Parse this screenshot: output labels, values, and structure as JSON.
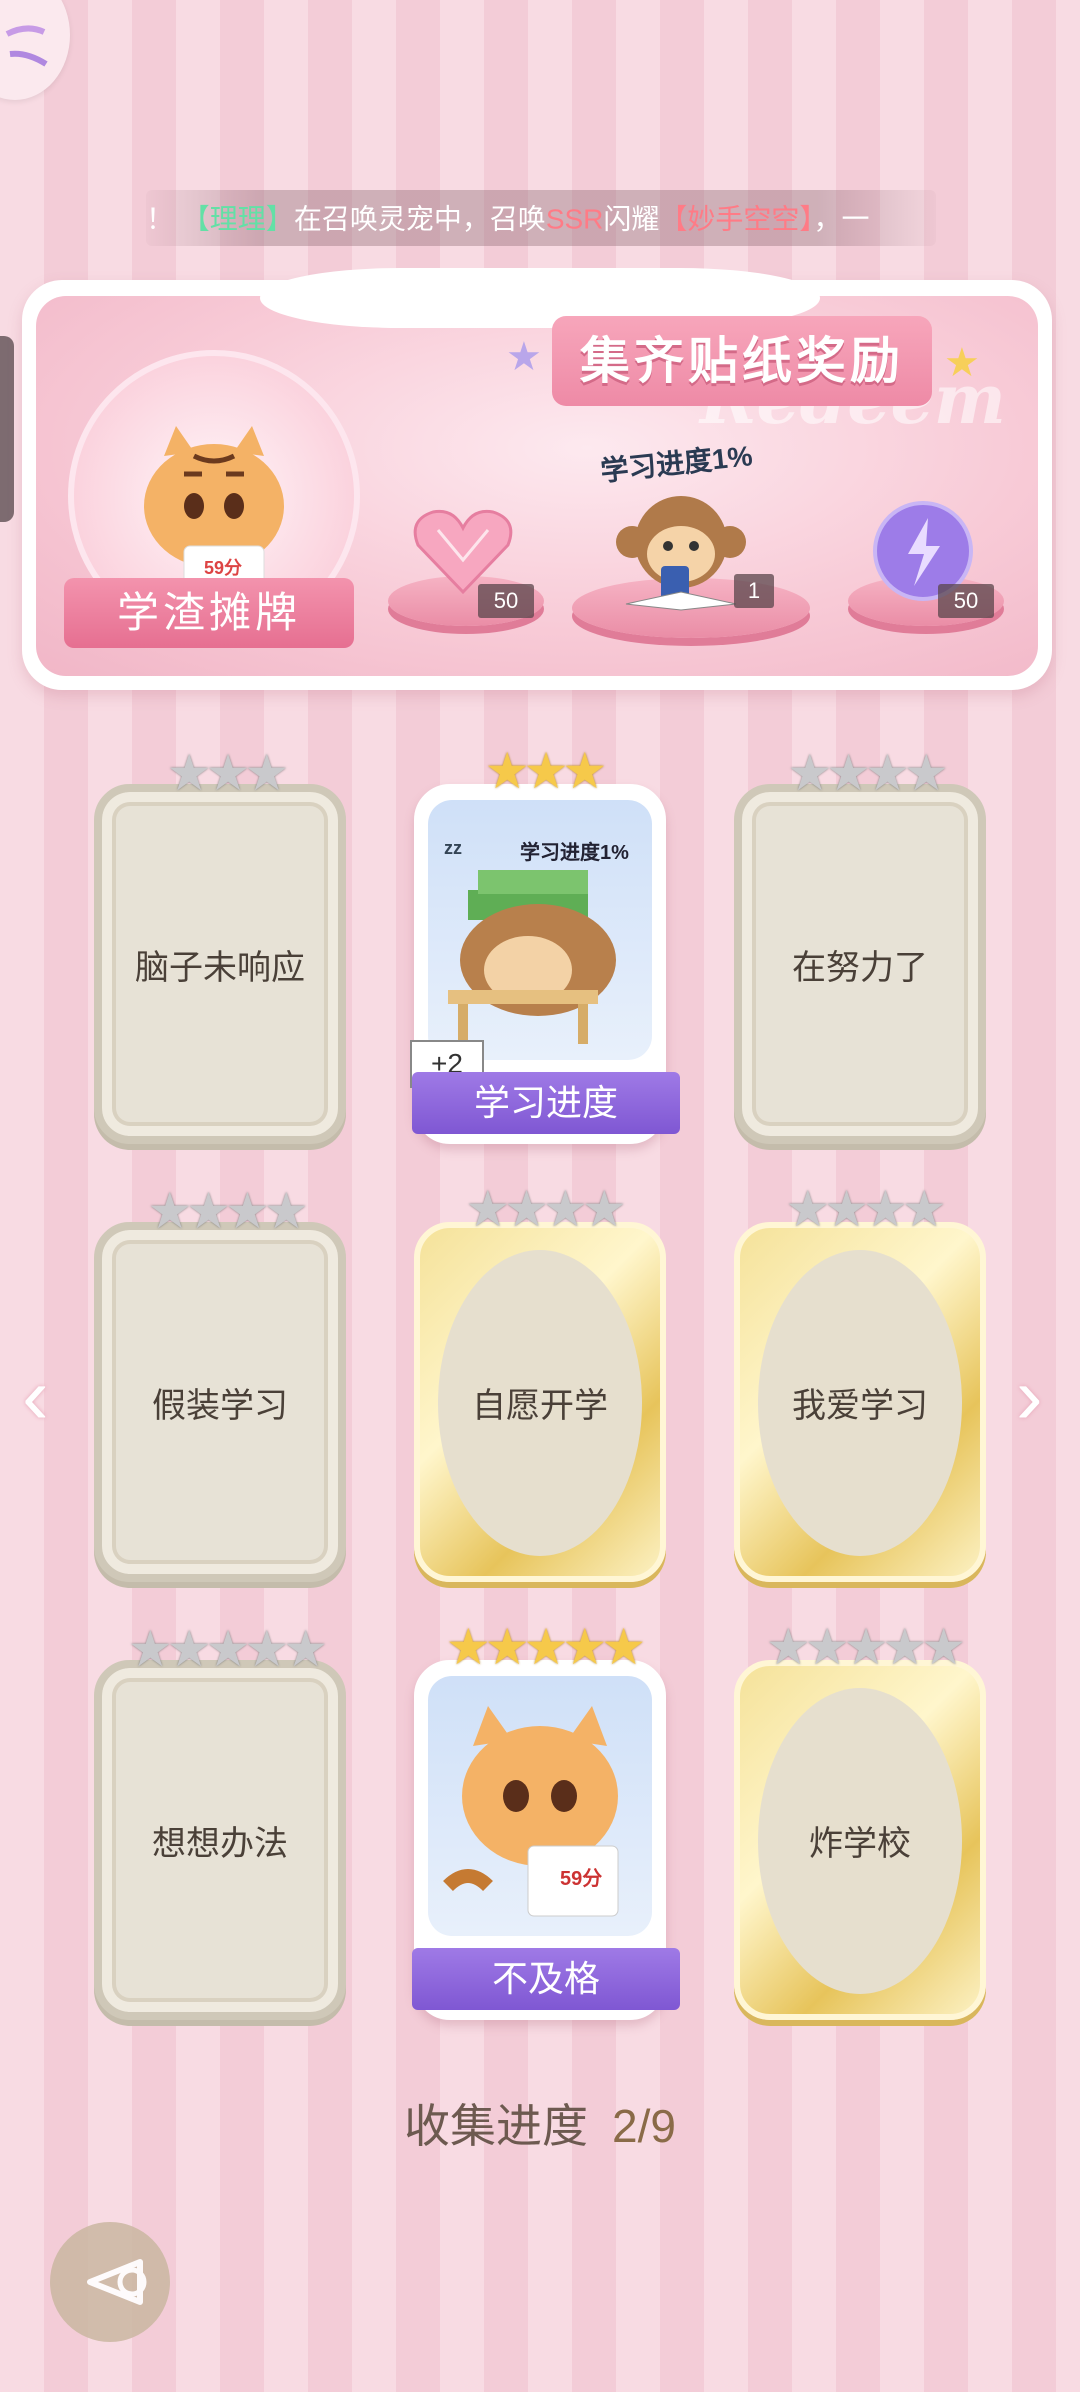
{
  "marquee": {
    "prefix": "！",
    "user": "【理理】",
    "mid": "在召唤灵宠中，召唤",
    "rarity": "SSR",
    "verb": "闪耀",
    "pet": "【妙手空空】",
    "suffix": "，一"
  },
  "banner": {
    "title": "集齐贴纸奖励",
    "watermark": "Redeem",
    "collection_name": "学渣摊牌",
    "avatar_note": "59分",
    "rewards": [
      {
        "icon": "pink-heart-gem-icon",
        "count": "50"
      },
      {
        "icon": "monkey-phone-icon",
        "count": "1",
        "caption": "学习进度1%"
      },
      {
        "icon": "purple-lightning-orb-icon",
        "count": "50"
      }
    ]
  },
  "cards": [
    {
      "id": "c1",
      "label": "脑子未响应",
      "stars": 3,
      "star_color": "gray",
      "style": "gray"
    },
    {
      "id": "c2",
      "label": "学习进度",
      "stars": 3,
      "star_color": "gold",
      "style": "img",
      "caption": "学习进度1%",
      "badge": "+2",
      "zz": "zz"
    },
    {
      "id": "c3",
      "label": "在努力了",
      "stars": 4,
      "star_color": "gray",
      "style": "gray"
    },
    {
      "id": "c4",
      "label": "假装学习",
      "stars": 4,
      "star_color": "gray",
      "style": "gray"
    },
    {
      "id": "c5",
      "label": "自愿开学",
      "stars": 4,
      "star_color": "gray",
      "style": "gold"
    },
    {
      "id": "c6",
      "label": "我爱学习",
      "stars": 4,
      "star_color": "gray",
      "style": "gold"
    },
    {
      "id": "c7",
      "label": "想想办法",
      "stars": 5,
      "star_color": "gray",
      "style": "gray"
    },
    {
      "id": "c8",
      "label": "不及格",
      "stars": 5,
      "star_color": "gold",
      "style": "img",
      "note": "59分"
    },
    {
      "id": "c9",
      "label": "炸学校",
      "stars": 5,
      "star_color": "gray",
      "style": "gold"
    }
  ],
  "progress": {
    "label": "收集进度",
    "value": "2/9"
  },
  "nav": {
    "prev": "‹",
    "next": "›"
  },
  "colors": {
    "accent_pink": "#ee8aa6",
    "banner_purple": "#8a63dc",
    "star_gold": "#f6c94a"
  }
}
